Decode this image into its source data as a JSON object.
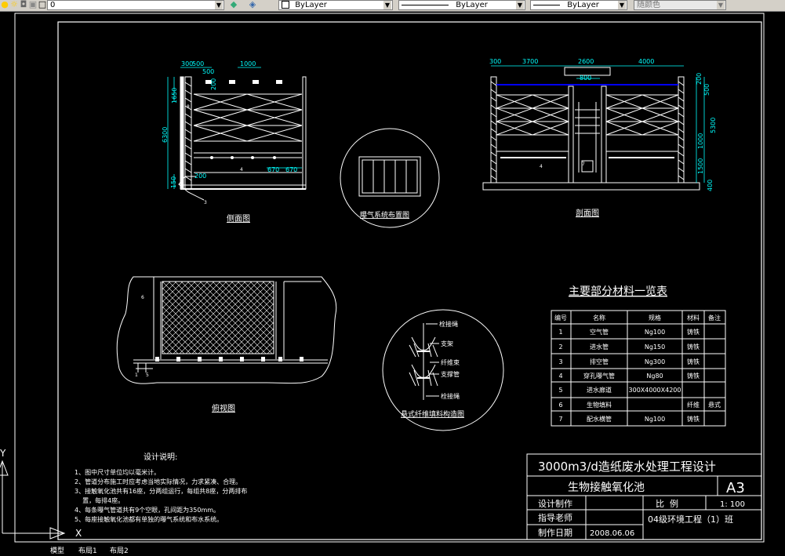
{
  "toolbar": {
    "layer_value": "0",
    "color_value": "ByLayer",
    "linetype_value": "ByLayer",
    "lineweight_value": "ByLayer",
    "plotstyle_value": "随颜色"
  },
  "drawing": {
    "side_view": {
      "title": "侧面图",
      "dims": [
        "300",
        "500",
        "1000",
        "500",
        "200",
        "1650",
        "6300",
        "150",
        "200",
        "670",
        "670"
      ],
      "callouts": [
        "8",
        "4",
        "3"
      ]
    },
    "aeration_layout": {
      "title": "曝气系统布置图"
    },
    "section_view": {
      "title": "剖面图",
      "dims": [
        "300",
        "3700",
        "2600",
        "4000",
        "800",
        "200",
        "500",
        "5300",
        "1000",
        "1500",
        "400"
      ],
      "callouts": [
        "4",
        "7"
      ]
    },
    "plan_view": {
      "title": "俯视图",
      "callouts": [
        "6",
        "1",
        "5"
      ]
    },
    "fiber_detail": {
      "title": "悬式纤维填料构造图",
      "labels": [
        "栓接绳",
        "支架",
        "纤维束",
        "支撑管",
        "栓接绳"
      ]
    },
    "design_notes": {
      "title": "设计说明:",
      "lines": [
        "1、图中尺寸单位均以毫米计。",
        "2、管道分布施工时应考虑当地实际情况，力求紧凑、合理。",
        "3、接触氧化池共有16座，分两组运行，每组共8座，分两排布",
        "    置，每排4座。",
        "4、每条曝气管道共有9个空眼，孔间距为350mm。",
        "5、每座接触氧化池都有单独的曝气系统和布水系统。"
      ]
    },
    "materials_table": {
      "title": "主要部分材料一览表",
      "headers": [
        "编号",
        "名称",
        "规格",
        "材料",
        "备注"
      ],
      "rows": [
        [
          "1",
          "空气管",
          "Ng100",
          "铸铁",
          ""
        ],
        [
          "2",
          "进水管",
          "Ng150",
          "铸铁",
          ""
        ],
        [
          "3",
          "排空管",
          "Ng300",
          "铸铁",
          ""
        ],
        [
          "4",
          "穿孔曝气管",
          "Ng80",
          "铸铁",
          ""
        ],
        [
          "5",
          "进水廊道",
          "300X4000X4200",
          "",
          ""
        ],
        [
          "6",
          "生物填料",
          "",
          "纤维",
          "悬式"
        ],
        [
          "7",
          "配水横管",
          "Ng100",
          "铸铁",
          ""
        ]
      ]
    },
    "title_block": {
      "project": "3000m3/d造纸废水处理工程设计",
      "drawing_name": "生物接触氧化池",
      "sheet_size": "A3",
      "design_label": "设计制作",
      "ratio_label": "比  例",
      "ratio_value": "1: 100",
      "advisor_label": "指导老师",
      "class_value": "04级环境工程（1）班",
      "date_label": "制作日期",
      "date_value": "2008.06.06"
    }
  },
  "ucs": {
    "x_label": "X",
    "y_label": "Y"
  },
  "tabs": [
    "模型",
    "布局1",
    "布局2"
  ],
  "colors": {
    "background": "#000000",
    "line": "#ffffff",
    "dim": "#00ffff",
    "water": "#0000ff",
    "label": "#ffff00"
  }
}
